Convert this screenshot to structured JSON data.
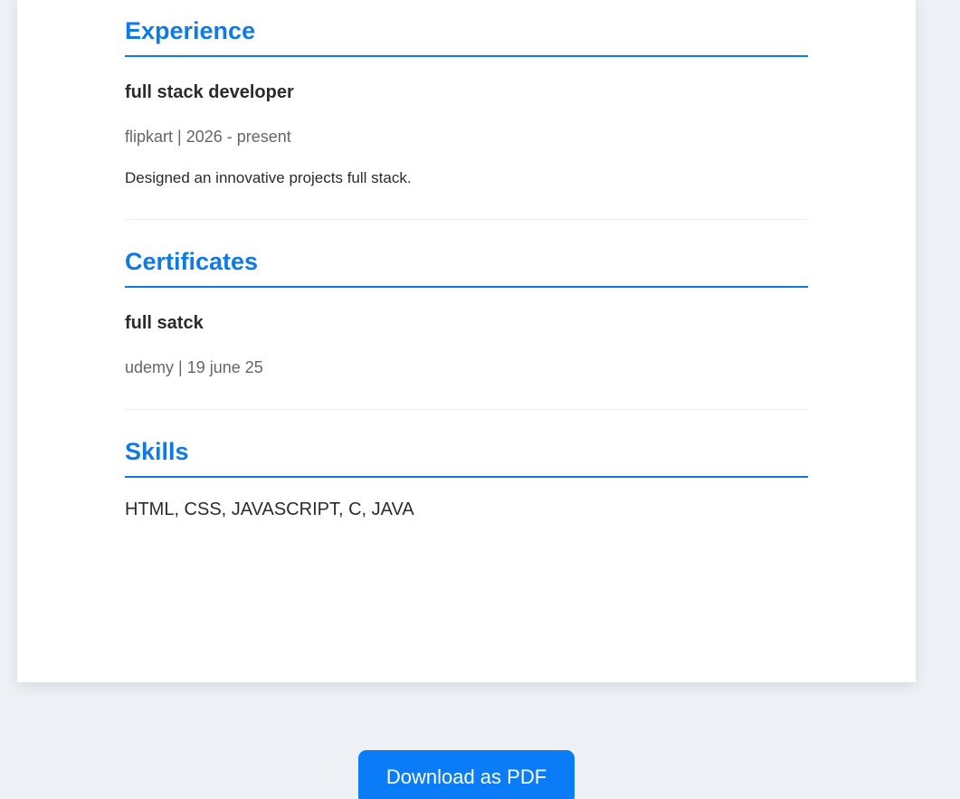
{
  "experience": {
    "heading": "Experience",
    "items": [
      {
        "role": "full stack developer",
        "meta": "flipkart | 2026 - present",
        "description": "Designed an innovative projects full stack."
      }
    ]
  },
  "certificates": {
    "heading": "Certificates",
    "items": [
      {
        "name": "full satck",
        "meta": "udemy | 19 june 25"
      }
    ]
  },
  "skills": {
    "heading": "Skills",
    "text": "HTML, CSS, JAVASCRIPT, C, JAVA"
  },
  "actions": {
    "download_label": "Download as PDF"
  },
  "colors": {
    "accent": "#0d7ae6",
    "button": "#0a7cf7",
    "background": "#edf1f5",
    "card": "#ffffff"
  }
}
